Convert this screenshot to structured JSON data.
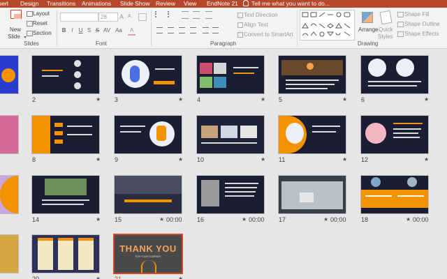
{
  "tabs": {
    "items": [
      "sert",
      "Design",
      "Transitions",
      "Animations",
      "Slide Show",
      "Review",
      "View",
      "EndNote 21"
    ],
    "tell_me": "Tell me what you want to do..."
  },
  "ribbon": {
    "slides": {
      "new_slide": "New",
      "new_slide_2": "Slide",
      "layout": "Layout",
      "reset": "Reset",
      "section": "Section",
      "label": "Slides"
    },
    "font": {
      "size_value": "28",
      "grow": "A",
      "shrink": "A",
      "bold": "B",
      "italic": "I",
      "underline": "U",
      "strike": "S",
      "shadow": "S",
      "spacing": "AV",
      "case": "Aa",
      "color": "A",
      "label": "Font"
    },
    "paragraph": {
      "text_direction": "Text Direction",
      "align_text": "Align Text",
      "convert_smartart": "Convert to SmartArt",
      "label": "Paragraph"
    },
    "drawing": {
      "arrange": "Arrange",
      "quick": "Quick",
      "styles": "Styles",
      "shape_fill": "Shape Fill",
      "shape_outline": "Shape Outline",
      "shape_effects": "Shape Effects",
      "label": "Drawing"
    }
  },
  "slides": [
    {
      "num": "2",
      "duration": ""
    },
    {
      "num": "3",
      "duration": ""
    },
    {
      "num": "4",
      "duration": ""
    },
    {
      "num": "5",
      "duration": ""
    },
    {
      "num": "6",
      "duration": ""
    },
    {
      "num": "8",
      "duration": ""
    },
    {
      "num": "9",
      "duration": ""
    },
    {
      "num": "10",
      "duration": ""
    },
    {
      "num": "11",
      "duration": ""
    },
    {
      "num": "12",
      "duration": ""
    },
    {
      "num": "14",
      "duration": ""
    },
    {
      "num": "15",
      "duration": "00:00"
    },
    {
      "num": "16",
      "duration": "00:00"
    },
    {
      "num": "17",
      "duration": "00:00"
    },
    {
      "num": "18",
      "duration": "00:00"
    },
    {
      "num": "20",
      "duration": ""
    },
    {
      "num": "21",
      "duration": ""
    }
  ],
  "slide21": {
    "title": "THANK YOU",
    "subtitle": "FOR YOUR COMPANY"
  },
  "colors": {
    "tab_bar": "#b7472a",
    "slide_dark": "#1b1d33",
    "accent_orange": "#f39200",
    "selection": "#d24726"
  },
  "icons": [
    "star-icon",
    "lightbulb-icon",
    "new-slide-icon",
    "shapes-gallery-icon",
    "arrange-icon",
    "quick-styles-icon",
    "shape-fill-icon",
    "shape-outline-icon",
    "shape-effects-icon"
  ]
}
